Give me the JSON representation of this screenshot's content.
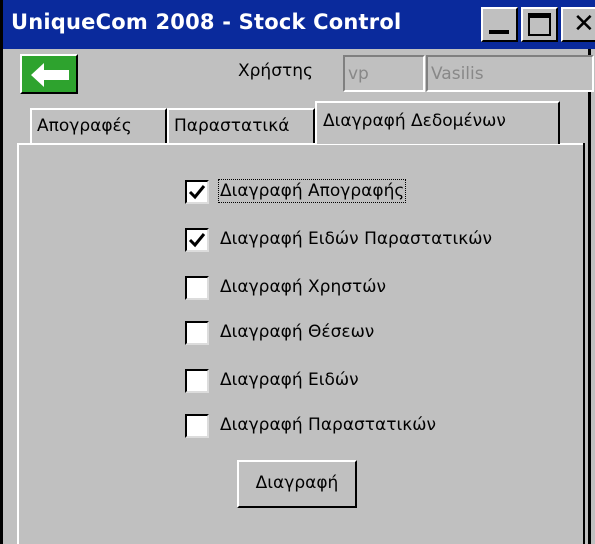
{
  "window": {
    "title": "UniqueCom 2008 - Stock Control"
  },
  "titlebar_buttons": {
    "minimize": "minimize-icon",
    "maximize": "maximize-icon",
    "close": "close-icon"
  },
  "header": {
    "back_icon": "arrow-left-icon",
    "user_label": "Χρήστης",
    "user_id": "vp",
    "user_name": "Vasilis"
  },
  "tabs": [
    {
      "label": "Απογραφές"
    },
    {
      "label": "Παραστατικά"
    },
    {
      "label": "Διαγραφή Δεδομένων",
      "active": true
    }
  ],
  "options": [
    {
      "label": "Διαγραφή Απογραφής",
      "checked": true,
      "focused": true
    },
    {
      "label": "Διαγραφή Ειδών Παραστατικών",
      "checked": true
    },
    {
      "label": "Διαγραφή Χρηστών",
      "checked": false
    },
    {
      "label": "Διαγραφή Θέσεων",
      "checked": false
    },
    {
      "label": "Διαγραφή Ειδών",
      "checked": false
    },
    {
      "label": "Διαγραφή Παραστατικών",
      "checked": false
    }
  ],
  "actions": {
    "delete_label": "Διαγραφή"
  },
  "colors": {
    "titlebar": "#0a2a9c",
    "back_button": "#2ea32e",
    "face": "#c0c0c0"
  }
}
